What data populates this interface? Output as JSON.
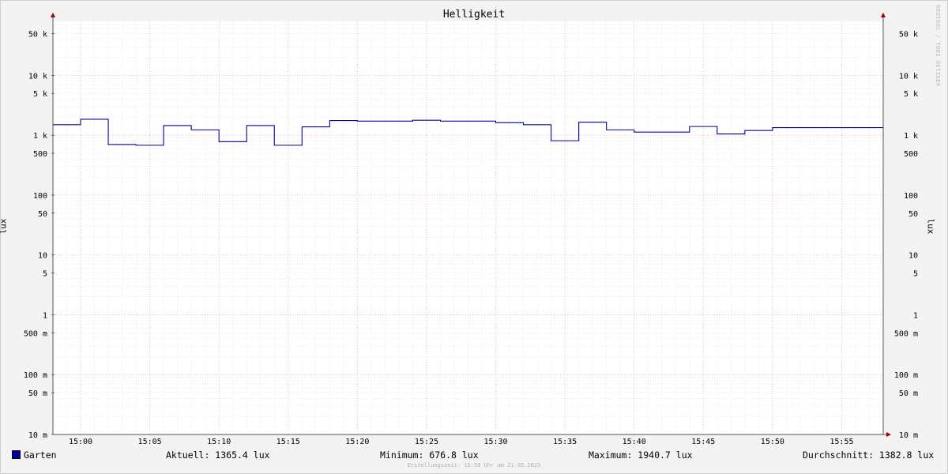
{
  "window": {
    "title": "Helligkeit",
    "watermark": "RRDTOOL / TOBI OETIKER"
  },
  "axes": {
    "left_label": "lux",
    "right_label": "lux"
  },
  "legend": {
    "series_name": "Garten",
    "series_color": "#00009c",
    "current": "Aktuell: 1365.4 lux",
    "minimum": "Minimum: 676.8 lux",
    "maximum": "Maximum: 1940.7 lux",
    "average": "Durchschnitt: 1382.8 lux"
  },
  "footer": "Erstellungszeit: 15:58 Uhr am 21.05.2025",
  "chart_data": {
    "type": "line",
    "step": true,
    "yscale": "log",
    "grid": true,
    "xlim": [
      "14:58",
      "15:58"
    ],
    "ylim": [
      0.01,
      80000
    ],
    "x_ticks": [
      "15:00",
      "15:05",
      "15:10",
      "15:15",
      "15:20",
      "15:25",
      "15:30",
      "15:35",
      "15:40",
      "15:45",
      "15:50",
      "15:55"
    ],
    "y_ticks": [
      {
        "v": 50000,
        "label": "50 k"
      },
      {
        "v": 10000,
        "label": "10 k"
      },
      {
        "v": 5000,
        "label": "5 k"
      },
      {
        "v": 1000,
        "label": "1 k"
      },
      {
        "v": 500,
        "label": "500"
      },
      {
        "v": 100,
        "label": "100"
      },
      {
        "v": 50,
        "label": "50"
      },
      {
        "v": 10,
        "label": "10"
      },
      {
        "v": 5,
        "label": "5"
      },
      {
        "v": 1,
        "label": "1"
      },
      {
        "v": 0.5,
        "label": "500 m"
      },
      {
        "v": 0.1,
        "label": "100 m"
      },
      {
        "v": 0.05,
        "label": "50 m"
      },
      {
        "v": 0.01,
        "label": "10 m"
      }
    ],
    "series": [
      {
        "name": "Garten",
        "x": [
          "14:58",
          "15:00",
          "15:02",
          "15:04",
          "15:06",
          "15:08",
          "15:10",
          "15:12",
          "15:14",
          "15:16",
          "15:18",
          "15:20",
          "15:22",
          "15:24",
          "15:26",
          "15:28",
          "15:30",
          "15:32",
          "15:34",
          "15:36",
          "15:38",
          "15:40",
          "15:42",
          "15:44",
          "15:46",
          "15:48",
          "15:50",
          "15:52",
          "15:54",
          "15:56",
          "15:58"
        ],
        "values": [
          1500,
          1850,
          700,
          680,
          1450,
          1230,
          780,
          1450,
          680,
          1380,
          1760,
          1720,
          1720,
          1780,
          1720,
          1720,
          1620,
          1500,
          810,
          1650,
          1230,
          1130,
          1130,
          1400,
          1050,
          1200,
          1340,
          1340,
          1340,
          1340,
          1340
        ]
      }
    ]
  }
}
